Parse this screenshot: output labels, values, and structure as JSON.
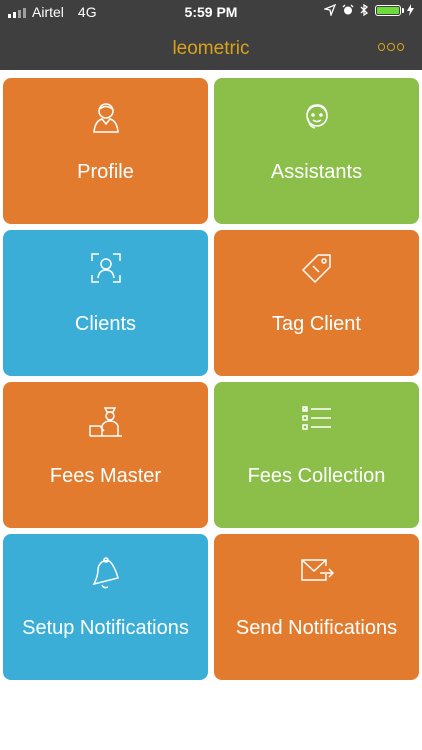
{
  "status_bar": {
    "carrier": "Airtel",
    "network": "4G",
    "time": "5:59 PM"
  },
  "app": {
    "title": "leometric"
  },
  "colors": {
    "orange": "#e27b2e",
    "green": "#8bbf4a",
    "blue": "#3aaed6",
    "header": "#3f3f3f",
    "accent": "#d8a21d"
  },
  "tiles": [
    {
      "label": "Profile",
      "icon": "profile-icon",
      "color": "orange"
    },
    {
      "label": "Assistants",
      "icon": "assistant-icon",
      "color": "green"
    },
    {
      "label": "Clients",
      "icon": "clients-icon",
      "color": "blue"
    },
    {
      "label": "Tag Client",
      "icon": "tag-icon",
      "color": "orange"
    },
    {
      "label": "Fees Master",
      "icon": "fees-master-icon",
      "color": "orange"
    },
    {
      "label": "Fees Collection",
      "icon": "list-icon",
      "color": "green"
    },
    {
      "label": "Setup Notifications",
      "icon": "bell-icon",
      "color": "blue"
    },
    {
      "label": "Send Notifications",
      "icon": "mail-icon",
      "color": "orange"
    }
  ]
}
